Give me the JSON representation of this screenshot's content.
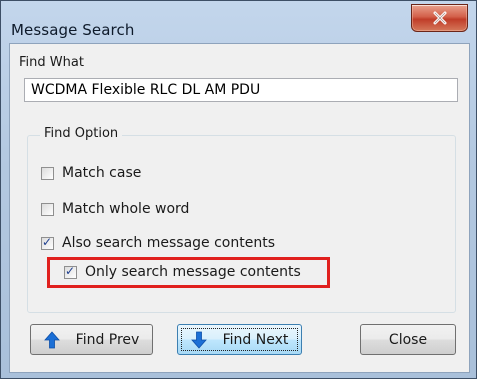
{
  "window": {
    "title": "Message Search"
  },
  "find_what": {
    "label": "Find What",
    "value": "WCDMA Flexible RLC DL AM PDU"
  },
  "find_option": {
    "title": "Find Option",
    "options": [
      {
        "label": "Match case",
        "checked": false
      },
      {
        "label": "Match whole word",
        "checked": false
      },
      {
        "label": "Also search message contents",
        "checked": true
      },
      {
        "label": "Only search message contents",
        "checked": true
      }
    ]
  },
  "buttons": {
    "prev": {
      "label": "Find Prev",
      "icon": "arrow-up-icon"
    },
    "next": {
      "label": "Find Next",
      "icon": "arrow-down-icon"
    },
    "close": {
      "label": "Close"
    }
  },
  "colors": {
    "highlight": "#e0201e",
    "arrow": "#1b6fd6"
  }
}
